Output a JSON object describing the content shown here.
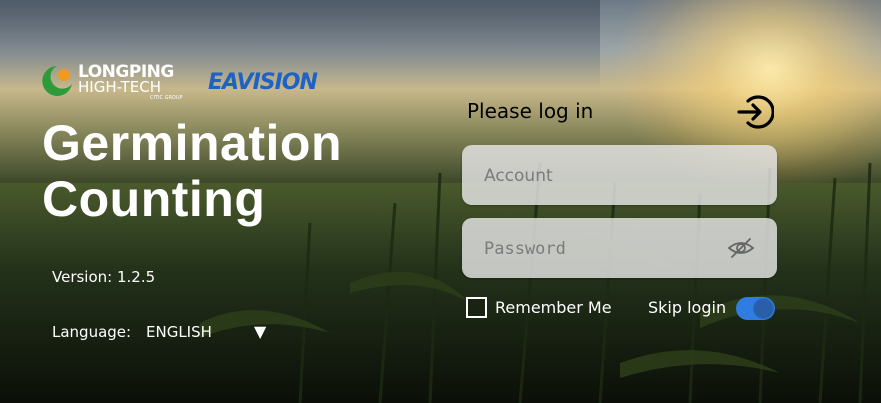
{
  "brand": {
    "longping_line1": "LONGPING",
    "longping_line2": "HIGH-TECH",
    "longping_sub": "CITIC GROUP",
    "eavision": "EAVISION",
    "colors": {
      "longping_green": "#2e9b3b",
      "longping_orange": "#f29a1f",
      "eavision_blue": "#1e63c4"
    }
  },
  "app": {
    "title_line1": "Germination",
    "title_line2": "Counting"
  },
  "info": {
    "version": "Version: 1.2.5",
    "language_label": "Language:",
    "language_value": "ENGLISH",
    "language_arrow": "▼"
  },
  "login": {
    "heading": "Please log in",
    "login_icon": "login-arrow-icon",
    "account_placeholder": "Account",
    "password_placeholder": "Password",
    "password_toggle_icon": "eye-slash-icon",
    "remember_label": "Remember Me",
    "remember_checked": false,
    "skip_label": "Skip login",
    "skip_enabled": true,
    "accent_color": "#2f7de1"
  }
}
